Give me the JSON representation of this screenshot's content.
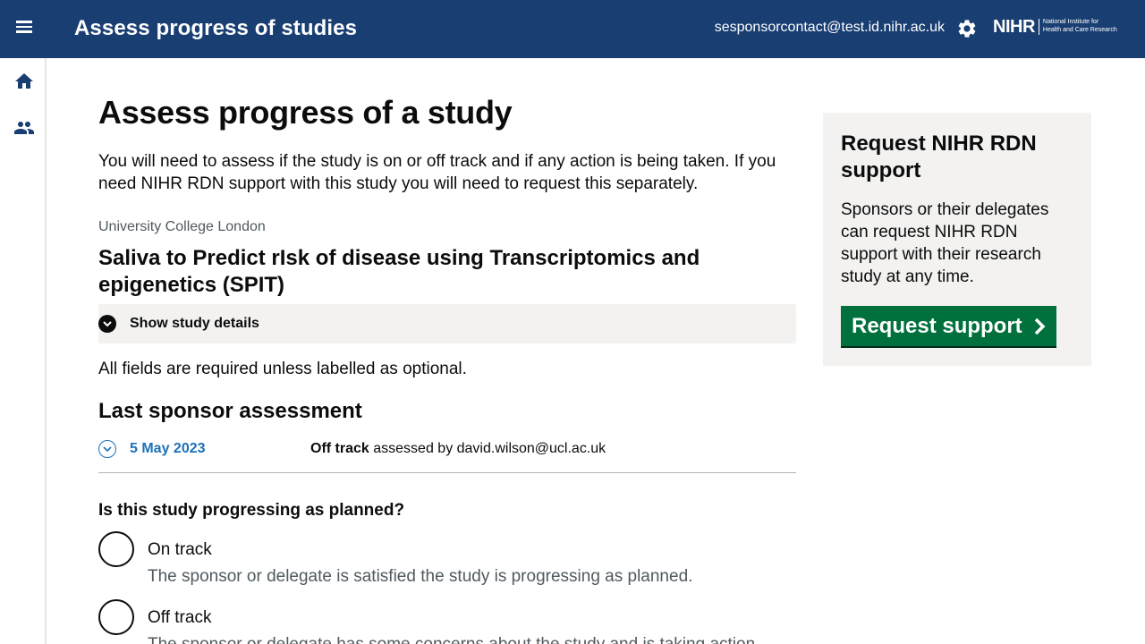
{
  "header": {
    "app_title": "Assess progress of studies",
    "user_email": "sesponsorcontact@test.id.nihr.ac.uk",
    "logo_main": "NIHR",
    "logo_sub_line1": "National Institute for",
    "logo_sub_line2": "Health and Care Research",
    "menu_icon": "menu-icon",
    "settings_icon": "gear-icon"
  },
  "sidenav": {
    "items": [
      {
        "icon": "home-icon"
      },
      {
        "icon": "people-icon"
      }
    ]
  },
  "main": {
    "title": "Assess progress of a study",
    "lede": "You will need to assess if the study is on or off track and if any action is being taken. If you need NIHR RDN support with this study you will need to request this separately.",
    "organisation": "University College London",
    "study_title": "Saliva to Predict rIsk of disease using Transcriptomics and epigenetics (SPIT)",
    "details_label": "Show study details",
    "required_note": "All fields are required unless labelled as optional.",
    "last_assessment_heading": "Last sponsor assessment",
    "last_assessment": {
      "date": "5 May 2023",
      "status": "Off track",
      "assessed_by_text": "assessed by david.wilson@ucl.ac.uk"
    },
    "question": "Is this study progressing as planned?",
    "options": [
      {
        "label": "On track",
        "hint": "The sponsor or delegate is satisfied the study is progressing as planned."
      },
      {
        "label": "Off track",
        "hint": "The sponsor or delegate has some concerns about the study and is taking action"
      }
    ]
  },
  "panel": {
    "title": "Request NIHR RDN support",
    "body": "Sponsors or their delegates can request NIHR RDN support with their research study at any time.",
    "button_label": "Request support"
  },
  "colors": {
    "header_bg": "#193e72",
    "link": "#1d70b8",
    "button_green": "#00703c",
    "panel_bg": "#f3f2f1"
  }
}
